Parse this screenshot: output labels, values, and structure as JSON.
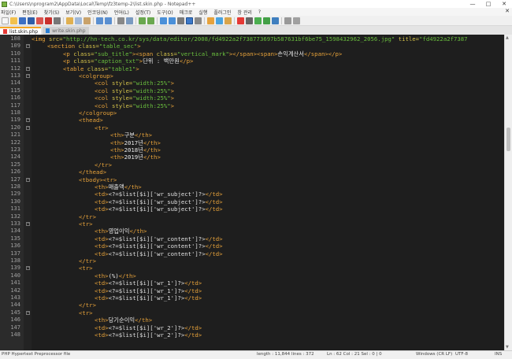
{
  "window": {
    "title": "C:\\Users\\nprogram2\\AppData\\Local\\Temp\\fz3temp-2\\list.skin.php - Notepad++",
    "controls": [
      "—",
      "□",
      "✕"
    ]
  },
  "menu": {
    "items": [
      "파일(F)",
      "편집(E)",
      "찾기(S)",
      "보기(V)",
      "인코딩(N)",
      "언어(L)",
      "설정(T)",
      "도구(O)",
      "매크로",
      "실행",
      "플러그인",
      "창 관리",
      "?"
    ],
    "close": "✕"
  },
  "tabs": [
    {
      "label": "list.skin.php",
      "active": true
    },
    {
      "label": "write.skin.php",
      "active": false
    }
  ],
  "editor": {
    "lines": [
      {
        "num": "108",
        "fold": "",
        "indent": 0,
        "segs": [
          [
            "tag",
            "<img "
          ],
          [
            "attr",
            "src="
          ],
          [
            "str",
            "\"http://hn-tech.co.kr/sys/data/editor/2008/fd4922a2f738773697b587631bf6be75_1598432962_2056.jpg\""
          ],
          [
            "attr",
            " title="
          ],
          [
            "str",
            "\"fd4922a2f7387"
          ]
        ]
      },
      {
        "num": "109",
        "fold": "-",
        "indent": 1,
        "segs": [
          [
            "tag",
            "<section "
          ],
          [
            "attr",
            "class="
          ],
          [
            "str",
            "\"table_sec\""
          ],
          [
            "tag",
            ">"
          ]
        ]
      },
      {
        "num": "110",
        "fold": "",
        "indent": 2,
        "segs": [
          [
            "tag",
            "<p "
          ],
          [
            "attr",
            "class="
          ],
          [
            "str",
            "\"sub_title\""
          ],
          [
            "tag",
            "><span "
          ],
          [
            "attr",
            "class="
          ],
          [
            "str",
            "\"vertical_mark\""
          ],
          [
            "tag",
            "></span><span>"
          ],
          [
            "txt",
            "손익계산서"
          ],
          [
            "tag",
            "</span></p>"
          ]
        ]
      },
      {
        "num": "111",
        "fold": "",
        "indent": 2,
        "segs": [
          [
            "tag",
            "<p "
          ],
          [
            "attr",
            "class="
          ],
          [
            "str",
            "\"caption_txt\""
          ],
          [
            "tag",
            ">"
          ],
          [
            "txt",
            "단위 : 백만원"
          ],
          [
            "tag",
            "</p>"
          ]
        ]
      },
      {
        "num": "112",
        "fold": "-",
        "indent": 2,
        "segs": [
          [
            "tag",
            "<table "
          ],
          [
            "attr",
            "class="
          ],
          [
            "str",
            "\"table1\""
          ],
          [
            "tag",
            ">"
          ]
        ]
      },
      {
        "num": "113",
        "fold": "-",
        "indent": 3,
        "segs": [
          [
            "tag",
            "<colgroup>"
          ]
        ]
      },
      {
        "num": "114",
        "fold": "",
        "indent": 4,
        "segs": [
          [
            "tag",
            "<col "
          ],
          [
            "attr",
            "style="
          ],
          [
            "str",
            "\"width:25%\""
          ],
          [
            "tag",
            ">"
          ]
        ]
      },
      {
        "num": "115",
        "fold": "",
        "indent": 4,
        "segs": [
          [
            "tag",
            "<col "
          ],
          [
            "attr",
            "style="
          ],
          [
            "str",
            "\"width:25%\""
          ],
          [
            "tag",
            ">"
          ]
        ]
      },
      {
        "num": "116",
        "fold": "",
        "indent": 4,
        "segs": [
          [
            "tag",
            "<col "
          ],
          [
            "attr",
            "style="
          ],
          [
            "str",
            "\"width:25%\""
          ],
          [
            "tag",
            ">"
          ]
        ]
      },
      {
        "num": "117",
        "fold": "",
        "indent": 4,
        "segs": [
          [
            "tag",
            "<col "
          ],
          [
            "attr",
            "style="
          ],
          [
            "str",
            "\"width:25%\""
          ],
          [
            "tag",
            ">"
          ]
        ]
      },
      {
        "num": "118",
        "fold": "",
        "indent": 3,
        "segs": [
          [
            "tag",
            "</colgroup>"
          ]
        ]
      },
      {
        "num": "119",
        "fold": "-",
        "indent": 3,
        "segs": [
          [
            "tag",
            "<thead>"
          ]
        ]
      },
      {
        "num": "120",
        "fold": "-",
        "indent": 4,
        "segs": [
          [
            "tag",
            "<tr>"
          ]
        ]
      },
      {
        "num": "121",
        "fold": "",
        "indent": 5,
        "segs": [
          [
            "tag",
            "<th>"
          ],
          [
            "txt",
            "구분"
          ],
          [
            "tag",
            "</th>"
          ]
        ]
      },
      {
        "num": "122",
        "fold": "",
        "indent": 5,
        "segs": [
          [
            "tag",
            "<th>"
          ],
          [
            "txt",
            "2017년"
          ],
          [
            "tag",
            "</th>"
          ]
        ]
      },
      {
        "num": "123",
        "fold": "",
        "indent": 5,
        "segs": [
          [
            "tag",
            "<th>"
          ],
          [
            "txt",
            "2018년"
          ],
          [
            "tag",
            "</th>"
          ]
        ]
      },
      {
        "num": "124",
        "fold": "",
        "indent": 5,
        "segs": [
          [
            "tag",
            "<th>"
          ],
          [
            "txt",
            "2019년"
          ],
          [
            "tag",
            "</th>"
          ]
        ]
      },
      {
        "num": "125",
        "fold": "",
        "indent": 4,
        "segs": [
          [
            "tag",
            "</tr>"
          ]
        ]
      },
      {
        "num": "126",
        "fold": "",
        "indent": 3,
        "segs": [
          [
            "tag",
            "</thead>"
          ]
        ]
      },
      {
        "num": "127",
        "fold": "-",
        "indent": 3,
        "segs": [
          [
            "tag",
            "<tbody><tr>"
          ]
        ]
      },
      {
        "num": "128",
        "fold": "",
        "indent": 4,
        "segs": [
          [
            "tag",
            "<th>"
          ],
          [
            "txt",
            "매출액"
          ],
          [
            "tag",
            "</th>"
          ]
        ]
      },
      {
        "num": "129",
        "fold": "",
        "indent": 4,
        "segs": [
          [
            "tag",
            "<td>"
          ],
          [
            "php",
            "<?=$list[$i]['wr_subject']?>"
          ],
          [
            "tag",
            "</td>"
          ]
        ]
      },
      {
        "num": "130",
        "fold": "",
        "indent": 4,
        "segs": [
          [
            "tag",
            "<td>"
          ],
          [
            "php",
            "<?=$list[$i]['wr_subject']?>"
          ],
          [
            "tag",
            "</td>"
          ]
        ]
      },
      {
        "num": "131",
        "fold": "",
        "indent": 4,
        "segs": [
          [
            "tag",
            "<td>"
          ],
          [
            "php",
            "<?=$list[$i]['wr_subject']?>"
          ],
          [
            "tag",
            "</td>"
          ]
        ]
      },
      {
        "num": "132",
        "fold": "",
        "indent": 3,
        "segs": [
          [
            "tag",
            "</tr>"
          ]
        ]
      },
      {
        "num": "133",
        "fold": "-",
        "indent": 3,
        "segs": [
          [
            "tag",
            "<tr>"
          ]
        ]
      },
      {
        "num": "134",
        "fold": "",
        "indent": 4,
        "segs": [
          [
            "tag",
            "<th>"
          ],
          [
            "txt",
            "영업이익"
          ],
          [
            "tag",
            "</th>"
          ]
        ]
      },
      {
        "num": "135",
        "fold": "",
        "indent": 4,
        "segs": [
          [
            "tag",
            "<td>"
          ],
          [
            "php",
            "<?=$list[$i]['wr_content']?>"
          ],
          [
            "tag",
            "</td>"
          ]
        ]
      },
      {
        "num": "136",
        "fold": "",
        "indent": 4,
        "segs": [
          [
            "tag",
            "<td>"
          ],
          [
            "php",
            "<?=$list[$i]['wr_content']?>"
          ],
          [
            "tag",
            "</td>"
          ]
        ]
      },
      {
        "num": "137",
        "fold": "",
        "indent": 4,
        "segs": [
          [
            "tag",
            "<td>"
          ],
          [
            "php",
            "<?=$list[$i]['wr_content']?>"
          ],
          [
            "tag",
            "</td>"
          ]
        ]
      },
      {
        "num": "138",
        "fold": "",
        "indent": 3,
        "segs": [
          [
            "tag",
            "</tr>"
          ]
        ]
      },
      {
        "num": "139",
        "fold": "-",
        "indent": 3,
        "segs": [
          [
            "tag",
            "<tr>"
          ]
        ]
      },
      {
        "num": "140",
        "fold": "",
        "indent": 4,
        "segs": [
          [
            "tag",
            "<th>"
          ],
          [
            "txt",
            "(%)"
          ],
          [
            "tag",
            "</th>"
          ]
        ]
      },
      {
        "num": "141",
        "fold": "",
        "indent": 4,
        "segs": [
          [
            "tag",
            "<td>"
          ],
          [
            "php",
            "<?=$list[$i]['wr_1']?>"
          ],
          [
            "tag",
            "</td>"
          ]
        ]
      },
      {
        "num": "142",
        "fold": "",
        "indent": 4,
        "segs": [
          [
            "tag",
            "<td>"
          ],
          [
            "php",
            "<?=$list[$i]['wr_1']?>"
          ],
          [
            "tag",
            "</td>"
          ]
        ]
      },
      {
        "num": "143",
        "fold": "",
        "indent": 4,
        "segs": [
          [
            "tag",
            "<td>"
          ],
          [
            "php",
            "<?=$list[$i]['wr_1']?>"
          ],
          [
            "tag",
            "</td>"
          ]
        ]
      },
      {
        "num": "144",
        "fold": "",
        "indent": 3,
        "segs": [
          [
            "tag",
            "</tr>"
          ]
        ]
      },
      {
        "num": "145",
        "fold": "-",
        "indent": 3,
        "segs": [
          [
            "tag",
            "<tr>"
          ]
        ]
      },
      {
        "num": "146",
        "fold": "",
        "indent": 4,
        "segs": [
          [
            "tag",
            "<th>"
          ],
          [
            "txt",
            "당기순이익"
          ],
          [
            "tag",
            "</th>"
          ]
        ]
      },
      {
        "num": "147",
        "fold": "",
        "indent": 4,
        "segs": [
          [
            "tag",
            "<td>"
          ],
          [
            "php",
            "<?=$list[$i]['wr_2']?>"
          ],
          [
            "tag",
            "</td>"
          ]
        ]
      },
      {
        "num": "148",
        "fold": "",
        "indent": 4,
        "segs": [
          [
            "tag",
            "<td>"
          ],
          [
            "php",
            "<?=$list[$i]['wr_2']?>"
          ],
          [
            "tag",
            "</td>"
          ]
        ]
      }
    ]
  },
  "status": {
    "filetype": "PHP Hypertext Preprocessor file",
    "length": "length : 11,844",
    "lines": "lines : 372",
    "position": "Ln : 62   Col : 21   Sel : 0 | 0",
    "eol": "Windows (CR LF)",
    "encoding": "UTF-8",
    "mode": "INS"
  },
  "colors": {
    "tag": "#e8a33a",
    "attribute": "#d4c24a",
    "string": "#6abf3e",
    "text": "#e8e8e8",
    "background": "#1e1e1e"
  }
}
